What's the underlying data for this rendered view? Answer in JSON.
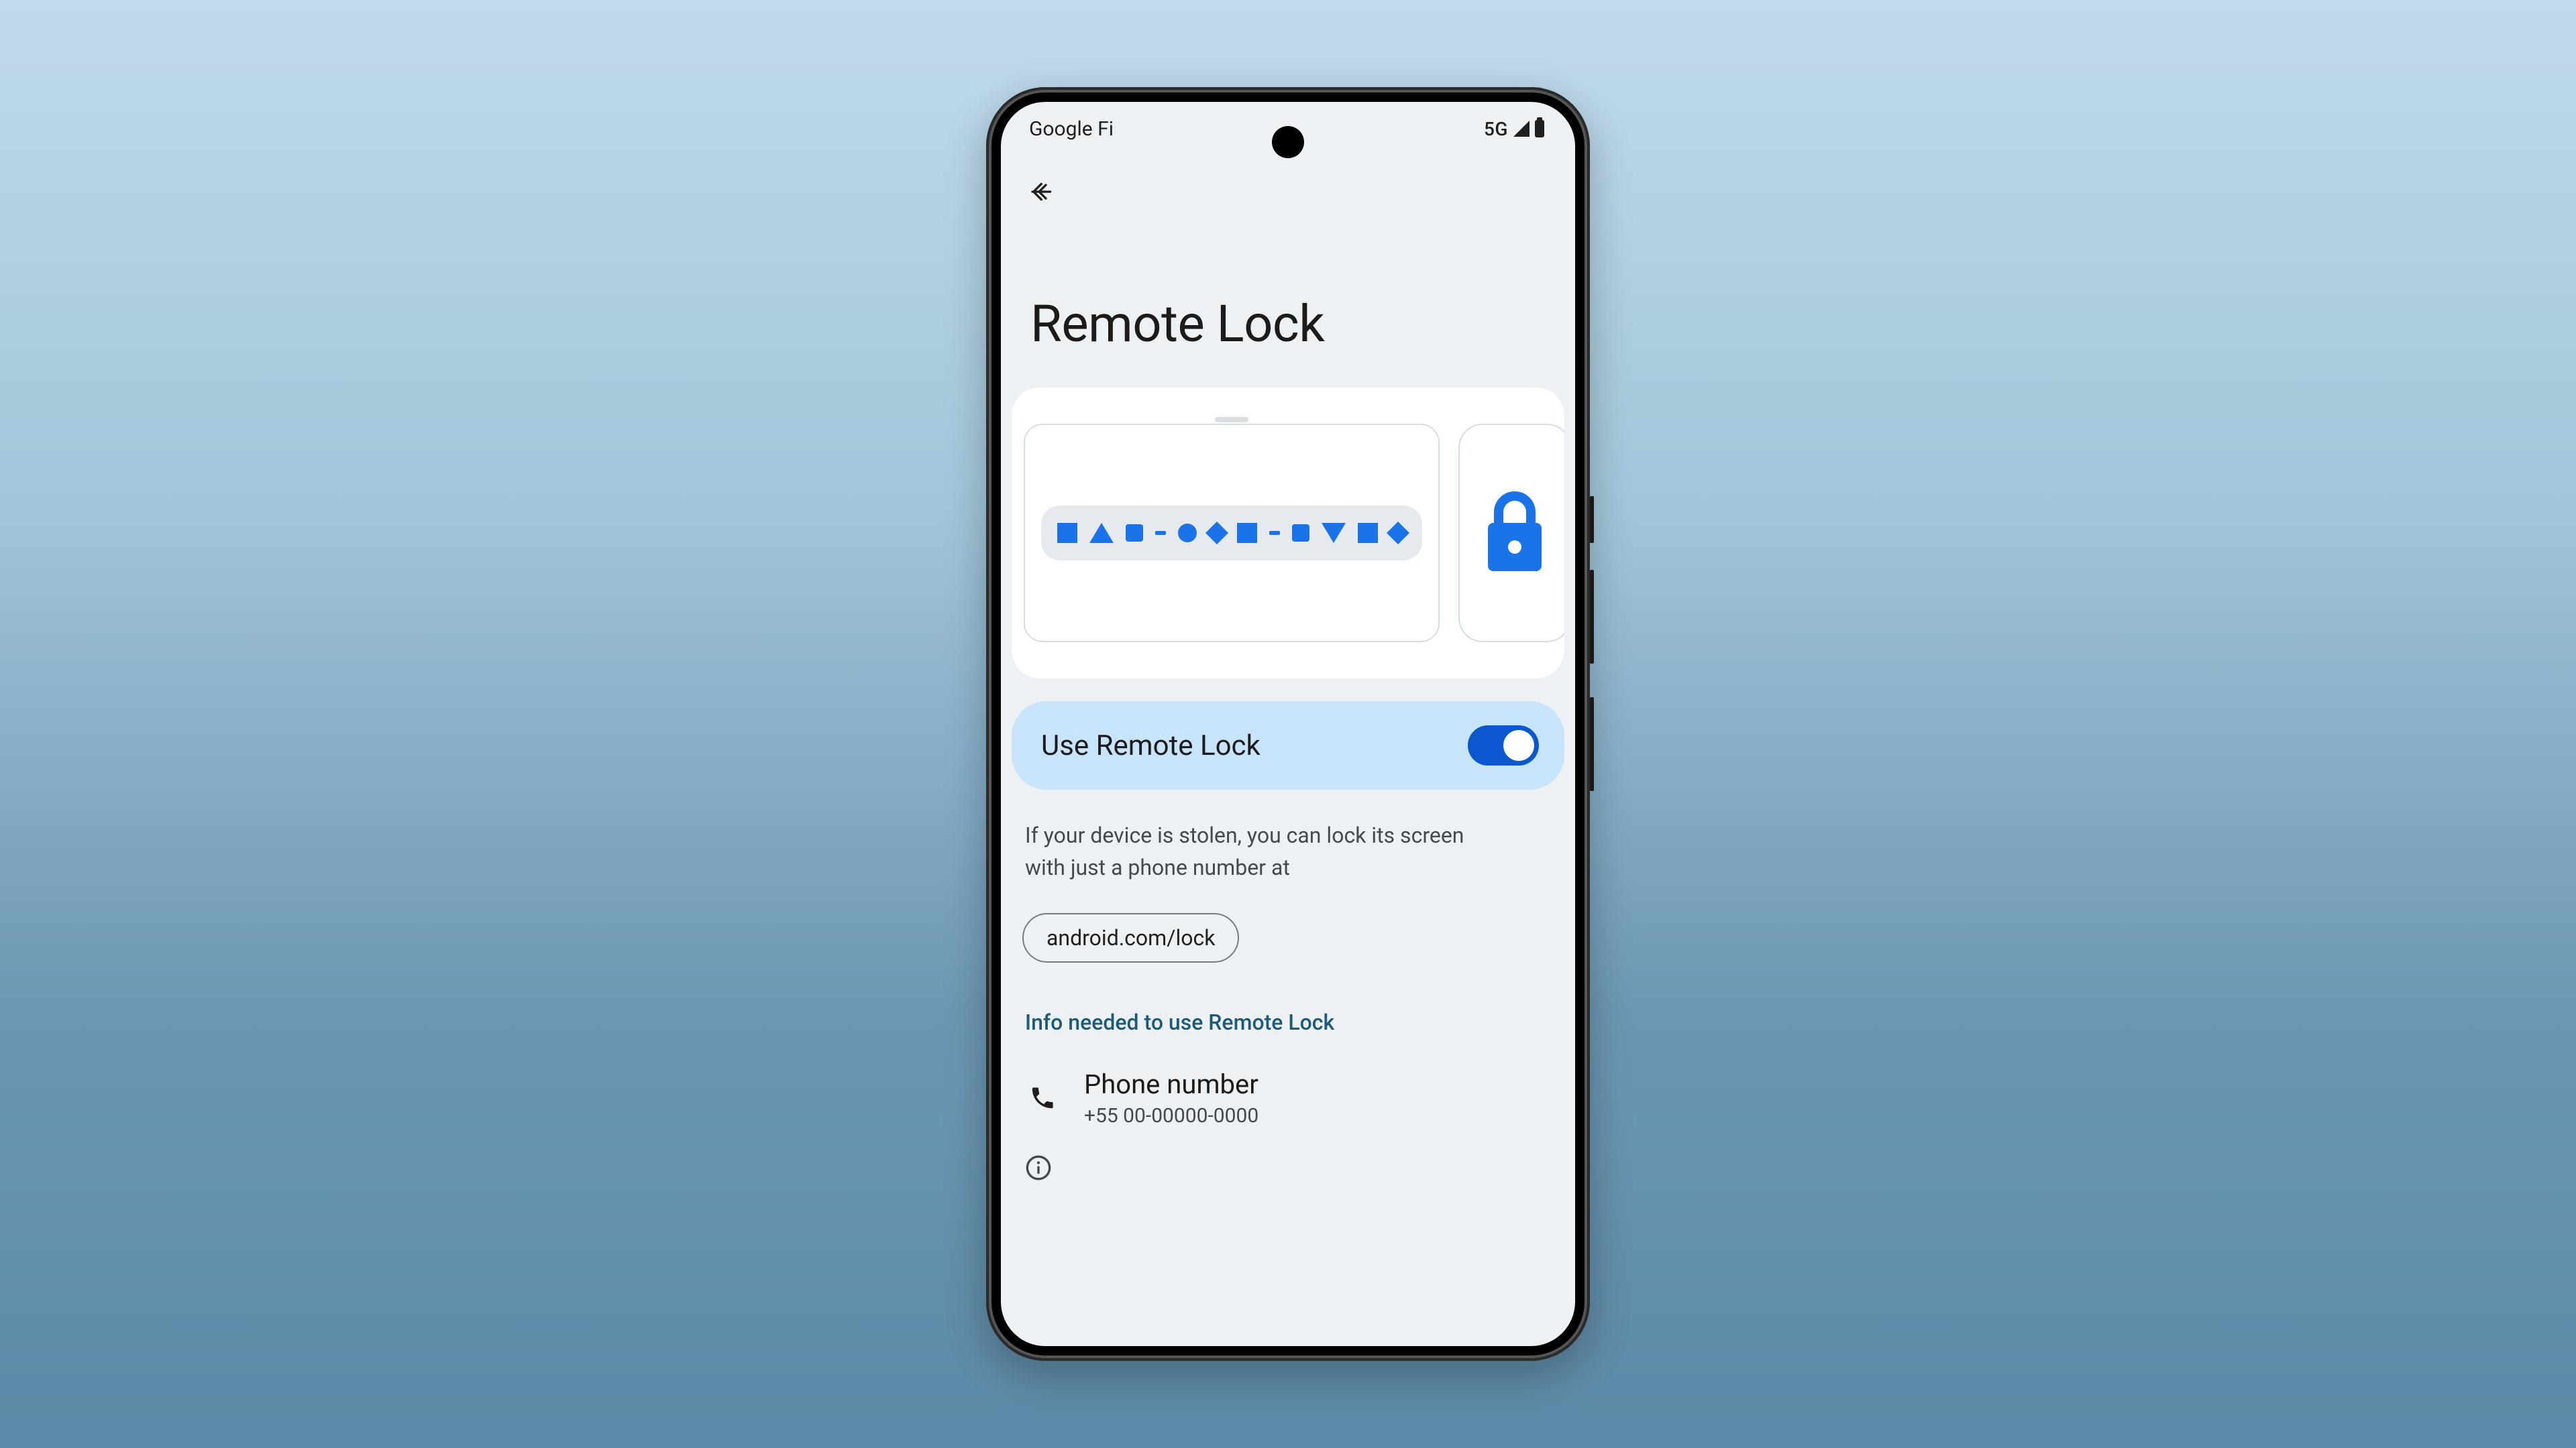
{
  "status": {
    "carrier": "Google Fi",
    "network": "5G"
  },
  "page": {
    "title": "Remote Lock"
  },
  "toggle": {
    "label": "Use Remote Lock",
    "on": true
  },
  "description": "If your device is stolen, you can lock its screen with just a phone number at",
  "chip": {
    "label": "android.com/lock"
  },
  "section_label": "Info needed to use Remote Lock",
  "phone_row": {
    "title": "Phone number",
    "value": "+55 00-00000-0000"
  }
}
